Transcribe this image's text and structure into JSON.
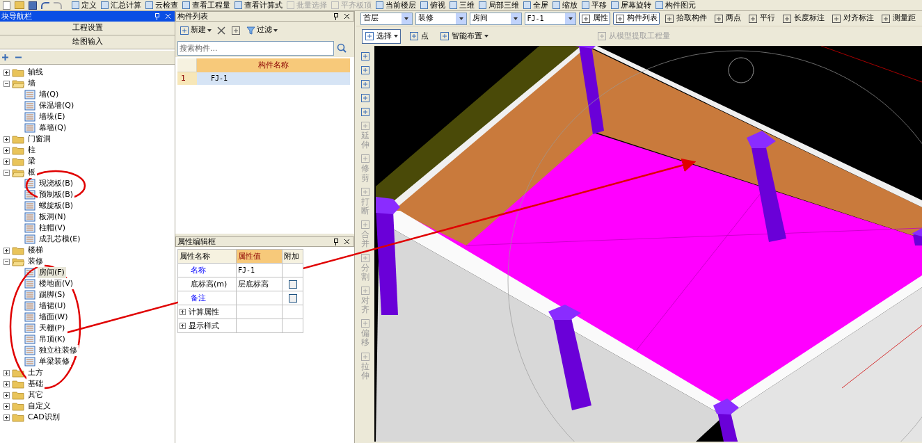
{
  "top_toolbar": [
    {
      "label": "定义",
      "disabled": false
    },
    {
      "label": "汇总计算",
      "disabled": false
    },
    {
      "label": "云检查",
      "disabled": false
    },
    {
      "label": "查看工程量",
      "disabled": false
    },
    {
      "label": "查看计算式",
      "disabled": false
    },
    {
      "label": "批量选择",
      "disabled": true
    },
    {
      "label": "平齐板顶",
      "disabled": true
    },
    {
      "label": "当前楼层",
      "disabled": false
    },
    {
      "label": "俯视",
      "disabled": false
    },
    {
      "label": "三维",
      "disabled": false
    },
    {
      "label": "局部三维",
      "disabled": false
    },
    {
      "label": "全屏",
      "disabled": false
    },
    {
      "label": "缩放",
      "disabled": false
    },
    {
      "label": "平移",
      "disabled": false
    },
    {
      "label": "屏幕旋转",
      "disabled": false
    },
    {
      "label": "构件图元",
      "disabled": false
    }
  ],
  "nav_panel": {
    "title": "块导航栏",
    "sections": [
      "工程设置",
      "绘图输入"
    ],
    "tree": [
      {
        "label": "轴线",
        "expanded": false,
        "selected": false
      },
      {
        "label": "墙",
        "expanded": true,
        "selected": false,
        "children": [
          {
            "label": "墙(Q)",
            "selected": false
          },
          {
            "label": "保温墙(Q)",
            "selected": false
          },
          {
            "label": "墙垛(E)",
            "selected": false
          },
          {
            "label": "幕墙(Q)",
            "selected": false
          }
        ]
      },
      {
        "label": "门窗洞",
        "expanded": false,
        "selected": false
      },
      {
        "label": "柱",
        "expanded": false,
        "selected": false
      },
      {
        "label": "梁",
        "expanded": false,
        "selected": false
      },
      {
        "label": "板",
        "expanded": true,
        "selected": false,
        "children": [
          {
            "label": "现浇板(B)",
            "selected": false
          },
          {
            "label": "预制板(B)",
            "selected": false
          },
          {
            "label": "螺旋板(B)",
            "selected": false
          },
          {
            "label": "板洞(N)",
            "selected": false
          },
          {
            "label": "柱帽(V)",
            "selected": false
          },
          {
            "label": "成孔芯模(E)",
            "selected": false
          }
        ]
      },
      {
        "label": "楼梯",
        "expanded": false,
        "selected": false
      },
      {
        "label": "装修",
        "expanded": true,
        "selected": false,
        "children": [
          {
            "label": "房间(F)",
            "selected": true
          },
          {
            "label": "楼地面(V)",
            "selected": false
          },
          {
            "label": "踢脚(S)",
            "selected": false
          },
          {
            "label": "墙裙(U)",
            "selected": false
          },
          {
            "label": "墙面(W)",
            "selected": false
          },
          {
            "label": "天棚(P)",
            "selected": false
          },
          {
            "label": "吊顶(K)",
            "selected": false
          },
          {
            "label": "独立柱装修",
            "selected": false
          },
          {
            "label": "单梁装修",
            "selected": false
          }
        ]
      },
      {
        "label": "土方",
        "expanded": false,
        "selected": false
      },
      {
        "label": "基础",
        "expanded": false,
        "selected": false
      },
      {
        "label": "其它",
        "expanded": false,
        "selected": false
      },
      {
        "label": "自定义",
        "expanded": false,
        "selected": false
      },
      {
        "label": "CAD识别",
        "expanded": false,
        "selected": false
      }
    ]
  },
  "component_list": {
    "title": "构件列表",
    "new_label": "新建",
    "filter_label": "过滤",
    "search": {
      "placeholder": "搜索构件..."
    },
    "column": "构件名称",
    "rows": [
      {
        "index": "1",
        "name": "FJ-1",
        "selected": true
      }
    ]
  },
  "property_editor": {
    "title": "属性编辑框",
    "columns": [
      "属性名称",
      "属性值",
      "附加"
    ],
    "rows": [
      {
        "kind": "field",
        "name": "名称",
        "value": "FJ-1",
        "highlighted": true,
        "has_checkbox": false
      },
      {
        "kind": "field",
        "name": "底标高(m)",
        "value": "层底标高",
        "highlighted": false,
        "has_checkbox": true,
        "checked": false
      },
      {
        "kind": "field",
        "name": "备注",
        "value": "",
        "highlighted": true,
        "has_checkbox": true,
        "checked": false
      },
      {
        "kind": "group",
        "name": "计算属性"
      },
      {
        "kind": "group",
        "name": "显示样式"
      }
    ]
  },
  "view_toolbar": {
    "dropdowns": [
      "首层",
      "装修",
      "房间",
      "FJ-1"
    ],
    "buttons": [
      {
        "label": "属性",
        "pressed": true
      },
      {
        "label": "构件列表",
        "pressed": true
      },
      {
        "label": "拾取构件",
        "pressed": false
      },
      {
        "label": "两点",
        "pressed": false
      },
      {
        "label": "平行",
        "pressed": false
      },
      {
        "label": "长度标注",
        "pressed": false
      },
      {
        "label": "对齐标注",
        "pressed": false
      },
      {
        "label": "测量距",
        "pressed": false
      }
    ],
    "row2": [
      {
        "label": "选择",
        "dropdown": true,
        "pressed": true,
        "disabled": false
      },
      {
        "label": "点",
        "dropdown": false,
        "pressed": false,
        "disabled": false
      },
      {
        "label": "智能布置",
        "dropdown": true,
        "pressed": false,
        "disabled": false
      },
      {
        "label": "从模型提取工程量",
        "dropdown": false,
        "pressed": false,
        "disabled": true
      }
    ]
  },
  "edit_toolbar": [
    {
      "label": "延伸"
    },
    {
      "label": "修剪"
    },
    {
      "label": "打断"
    },
    {
      "label": "合并"
    },
    {
      "label": "分割"
    },
    {
      "label": "对齐"
    },
    {
      "label": "偏移"
    },
    {
      "label": "拉伸"
    }
  ]
}
